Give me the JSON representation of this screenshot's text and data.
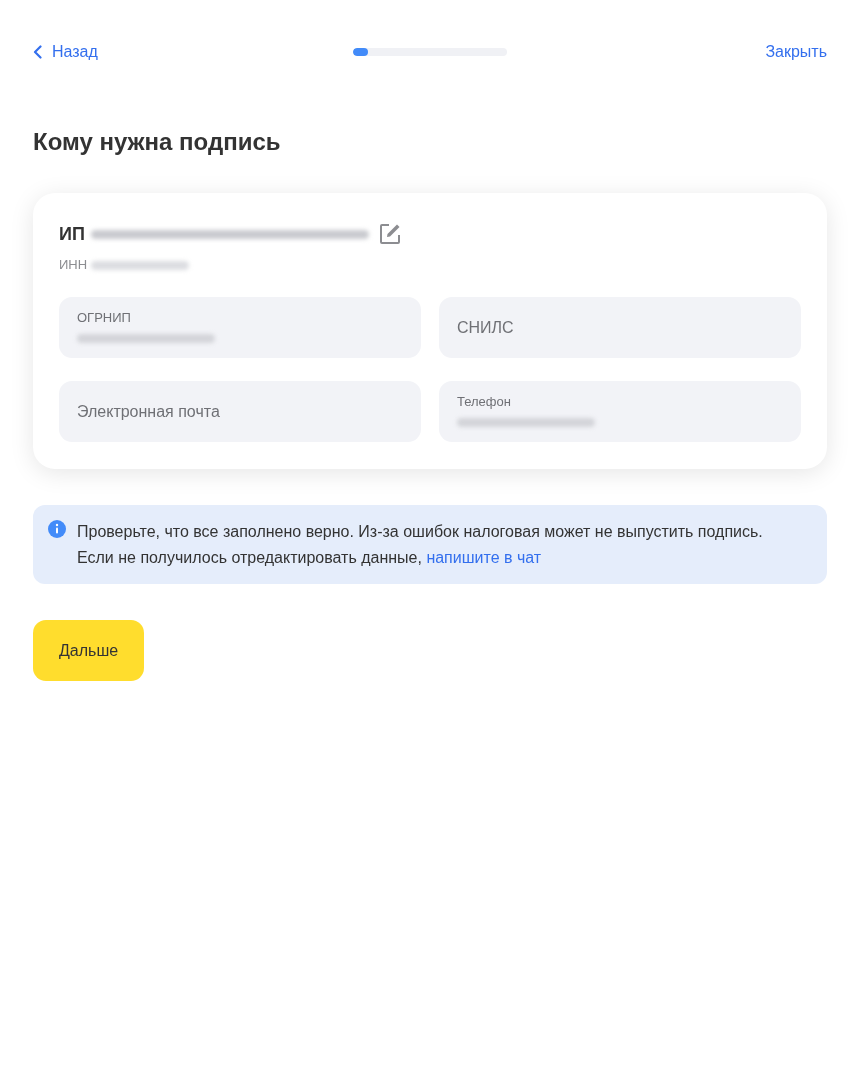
{
  "header": {
    "back": {
      "label": "Назад"
    },
    "progress": {
      "level": 0.1
    },
    "close": {
      "label": "Закрыть"
    }
  },
  "title": "Кому нужна подпись",
  "card": {
    "name": {
      "prefix": "ИП",
      "blurred": true,
      "editable": true
    },
    "inn": {
      "label": "ИНН",
      "blurred": true
    },
    "fields": [
      {
        "kind": "filled",
        "label": "ОГРНИП",
        "blurred_value": true
      },
      {
        "kind": "empty",
        "placeholder": "СНИЛС"
      },
      {
        "kind": "empty",
        "placeholder": "Электронная почта"
      },
      {
        "kind": "filled",
        "label": "Телефон",
        "blurred_value": true
      }
    ]
  },
  "notice": {
    "text": "Проверьте, что все заполнено верно. Из-за ошибок налоговая может не выпустить подпись. Если не получилось отредактировать данные,",
    "link": "напишите в чат"
  },
  "buttons": [
    {
      "label": "Дальше"
    }
  ]
}
